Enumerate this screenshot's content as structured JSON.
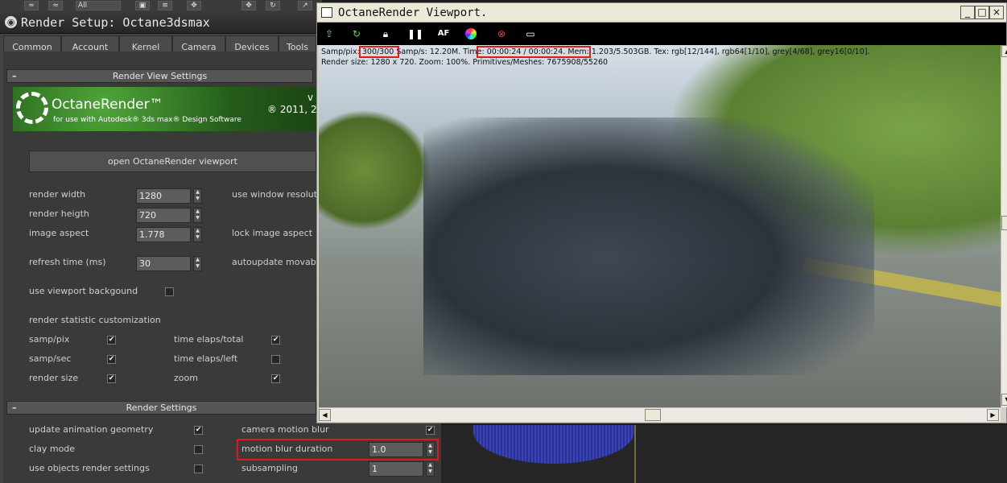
{
  "top_strip": {
    "dropdown": "All",
    "arrow": "↗"
  },
  "render_setup": {
    "title": "Render Setup: Octane3dsmax",
    "tabs": [
      "Common",
      "Account",
      "Kernel",
      "Camera",
      "Devices",
      "Tools"
    ],
    "view_rollout": {
      "title": "Render View Settings",
      "collapse": "–",
      "banner": {
        "brand": "OctaneRender™",
        "subtitle": "for use with Autodesk® 3ds max® Design Software",
        "copyright": "® 2011, 2",
        "version": "v"
      },
      "open_button": "open OctaneRender viewport",
      "render_width": {
        "label": "render width",
        "value": "1280"
      },
      "render_height": {
        "label": "render heigth",
        "value": "720"
      },
      "image_aspect": {
        "label": "image aspect",
        "value": "1.778"
      },
      "refresh_time": {
        "label": "refresh time (ms)",
        "value": "30"
      },
      "use_window_resolution": "use window resolutio",
      "lock_image_aspect": "lock image aspect",
      "autoupdate": "autoupdate movable p",
      "use_viewport_background": "use viewport backgound",
      "stat_header": "render statistic customization",
      "stats": [
        {
          "label": "samp/pix",
          "checked": true
        },
        {
          "label": "time elaps/total",
          "checked": true
        },
        {
          "label": "samp/sec",
          "checked": true
        },
        {
          "label": "time elaps/left",
          "checked": false
        },
        {
          "label": "render size",
          "checked": true
        },
        {
          "label": "zoom",
          "checked": true
        }
      ]
    },
    "render_rollout": {
      "title": "Render Settings",
      "collapse": "–",
      "update_animation_geometry": {
        "label": "update animation geometry",
        "checked": true
      },
      "clay_mode": {
        "label": "clay mode",
        "checked": false
      },
      "use_objects_render_settings": {
        "label": "use objects render settings",
        "checked": false
      },
      "camera_motion_blur": {
        "label": "camera motion blur",
        "checked": true
      },
      "motion_blur_duration": {
        "label": "motion blur duration",
        "value": "1.0"
      },
      "subsampling": {
        "label": "subsampling",
        "value": "1"
      }
    }
  },
  "viewport": {
    "title": "OctaneRender Viewport.",
    "window_buttons": [
      "_",
      "□",
      "×"
    ],
    "stats_line1": "Samp/pix: 300/300  Samp/s: 12.20M.  Time: 00:00:24 / 00:00:24.  Mem: 1.203/5.503GB.  Tex: rgb[12/144], rgb64[1/10], grey[4/68], grey16[0/10].",
    "stats_line2": "Render size: 1280 x 720.  Zoom: 100%.  Primitives/Meshes: 7675908/55260",
    "toolbar_icons": [
      "export-icon",
      "refresh-icon",
      "lock-icon",
      "pause-icon",
      "af-icon",
      "color-wheel-icon",
      "stop-icon",
      "monitor-icon"
    ],
    "af_label": "AF",
    "pause_label": "❚❚"
  },
  "colors": {
    "highlight": "#e01818",
    "dark_panel": "#444444"
  }
}
